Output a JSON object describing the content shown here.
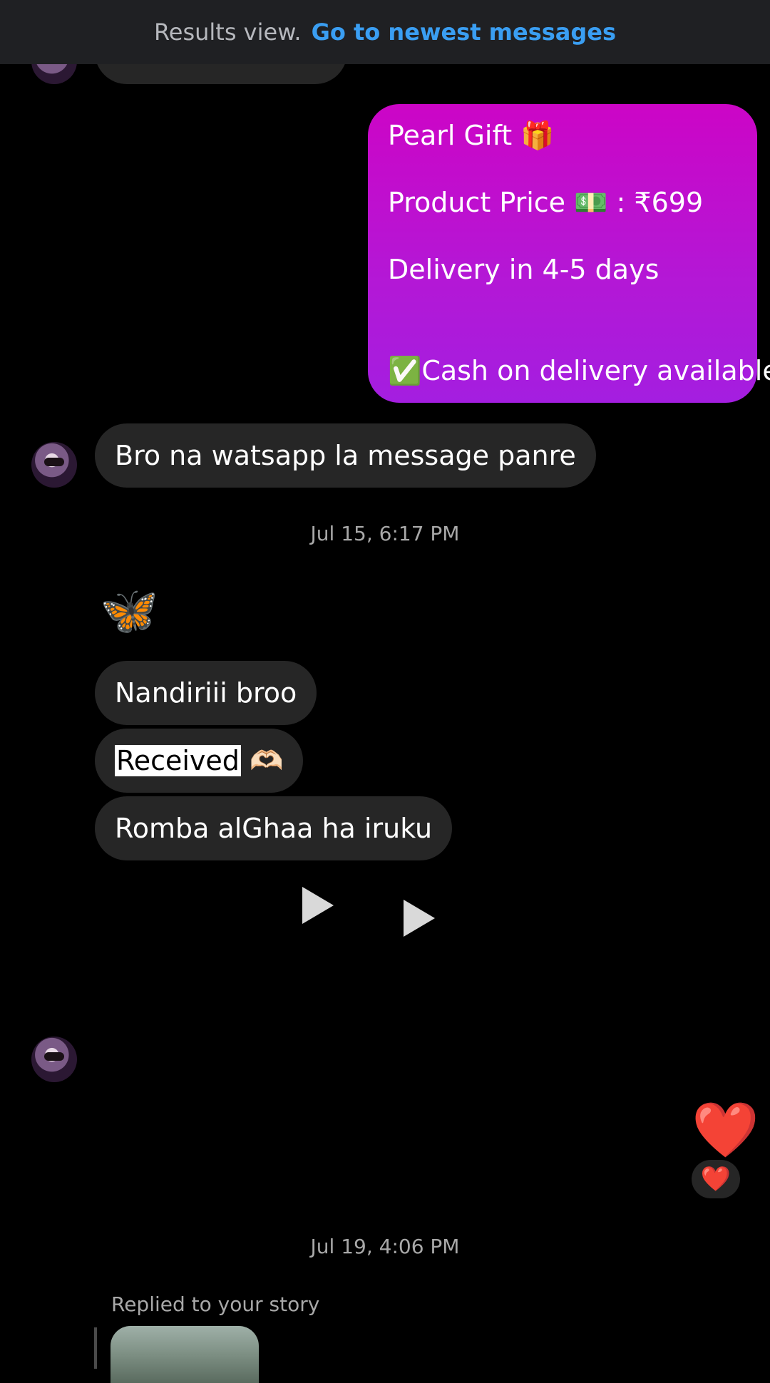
{
  "banner": {
    "muted_text": "Results view.",
    "link_text": "Go to newest messages"
  },
  "outgoing_message": {
    "line1": "Pearl Gift 🎁",
    "line2": "Product Price 💵 : ₹699",
    "line3": "Delivery in 4-5 days",
    "line4": "✅Cash on delivery available"
  },
  "incoming_1": {
    "text": "Bro na watsapp la message panre"
  },
  "timestamp_1": "Jul 15, 6:17 PM",
  "butterfly_emoji": "🦋",
  "incoming_group": {
    "msg1": "Nandiriii broo",
    "msg2_highlight": "Received",
    "msg2_emoji": "🫶🏻",
    "msg3": "Romba alGhaa ha iruku"
  },
  "heart_emoji": "❤️",
  "reaction_emoji": "❤️",
  "timestamp_2": "Jul 19, 4:06 PM",
  "story": {
    "label": "Replied to your story"
  },
  "icons": {
    "play": "play-icon",
    "avatar": "avatar"
  }
}
